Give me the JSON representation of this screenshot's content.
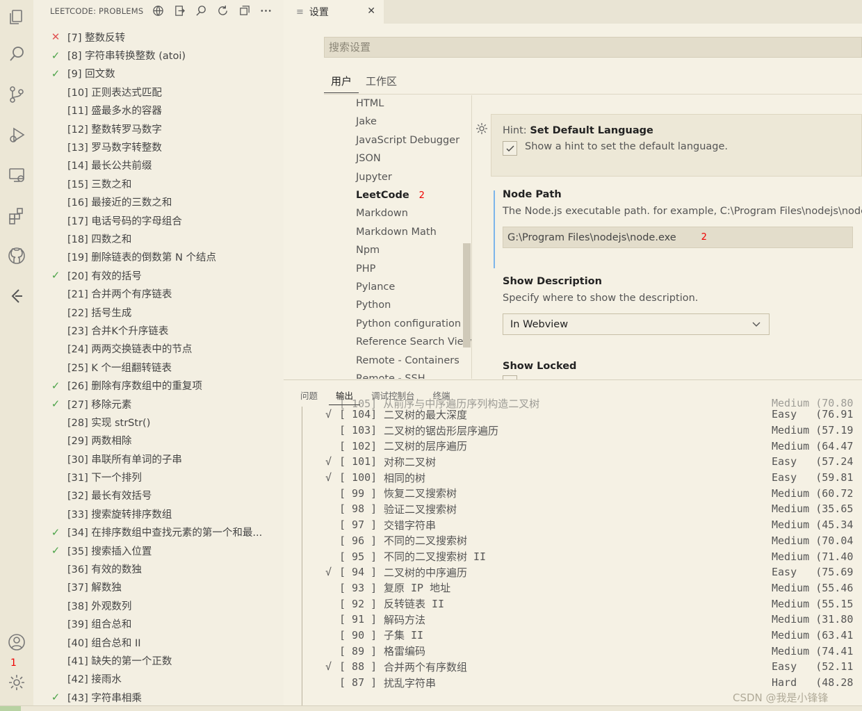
{
  "sidebar": {
    "title": "LEETCODE: PROBLEMS",
    "problems": [
      {
        "status": "fail",
        "label": "[7] 整数反转"
      },
      {
        "status": "ok",
        "label": "[8] 字符串转换整数 (atoi)"
      },
      {
        "status": "ok",
        "label": "[9] 回文数"
      },
      {
        "status": "",
        "label": "[10] 正则表达式匹配"
      },
      {
        "status": "",
        "label": "[11] 盛最多水的容器"
      },
      {
        "status": "",
        "label": "[12] 整数转罗马数字"
      },
      {
        "status": "",
        "label": "[13] 罗马数字转整数"
      },
      {
        "status": "",
        "label": "[14] 最长公共前缀"
      },
      {
        "status": "",
        "label": "[15] 三数之和"
      },
      {
        "status": "",
        "label": "[16] 最接近的三数之和"
      },
      {
        "status": "",
        "label": "[17] 电话号码的字母组合"
      },
      {
        "status": "",
        "label": "[18] 四数之和"
      },
      {
        "status": "",
        "label": "[19] 删除链表的倒数第 N 个结点"
      },
      {
        "status": "ok",
        "label": "[20] 有效的括号"
      },
      {
        "status": "",
        "label": "[21] 合并两个有序链表"
      },
      {
        "status": "",
        "label": "[22] 括号生成"
      },
      {
        "status": "",
        "label": "[23] 合并K个升序链表"
      },
      {
        "status": "",
        "label": "[24] 两两交换链表中的节点"
      },
      {
        "status": "",
        "label": "[25] K 个一组翻转链表"
      },
      {
        "status": "ok",
        "label": "[26] 删除有序数组中的重复项"
      },
      {
        "status": "ok",
        "label": "[27] 移除元素"
      },
      {
        "status": "",
        "label": "[28] 实现 strStr()"
      },
      {
        "status": "",
        "label": "[29] 两数相除"
      },
      {
        "status": "",
        "label": "[30] 串联所有单词的子串"
      },
      {
        "status": "",
        "label": "[31] 下一个排列"
      },
      {
        "status": "",
        "label": "[32] 最长有效括号"
      },
      {
        "status": "",
        "label": "[33] 搜索旋转排序数组"
      },
      {
        "status": "ok",
        "label": "[34] 在排序数组中查找元素的第一个和最..."
      },
      {
        "status": "ok",
        "label": "[35] 搜索插入位置"
      },
      {
        "status": "",
        "label": "[36] 有效的数独"
      },
      {
        "status": "",
        "label": "[37] 解数独"
      },
      {
        "status": "",
        "label": "[38] 外观数列"
      },
      {
        "status": "",
        "label": "[39] 组合总和"
      },
      {
        "status": "",
        "label": "[40] 组合总和 II"
      },
      {
        "status": "",
        "label": "[41] 缺失的第一个正数"
      },
      {
        "status": "",
        "label": "[42] 接雨水"
      },
      {
        "status": "ok",
        "label": "[43] 字符串相乘"
      }
    ]
  },
  "activity": {
    "badge": "1"
  },
  "editor": {
    "tab_label": "设置",
    "tab_icon": "≡",
    "close": "✕"
  },
  "settings": {
    "search_placeholder": "搜索设置",
    "scopes": [
      "用户",
      "工作区"
    ],
    "toc": [
      "HTML",
      "Jake",
      "JavaScript Debugger",
      "JSON",
      "Jupyter",
      "LeetCode",
      "Markdown",
      "Markdown Math",
      "Npm",
      "PHP",
      "Pylance",
      "Python",
      "Python configuration",
      "Reference Search View",
      "Remote - Containers",
      "Remote - SSH"
    ],
    "toc_active": "LeetCode",
    "toc_active_count": "2",
    "hint": {
      "category": "Hint: ",
      "title": "Set Default Language",
      "desc": "Show a hint to set the default language.",
      "checked": true
    },
    "node_path": {
      "title": "Node Path",
      "desc": "The Node.js executable path. for example, C:\\Program Files\\nodejs\\node.exe",
      "value": "G:\\Program Files\\nodejs\\node.exe",
      "badge": "2"
    },
    "show_description": {
      "title": "Show Description",
      "desc": "Specify where to show the description.",
      "value": "In Webview"
    },
    "show_locked": {
      "title": "Show Locked"
    }
  },
  "panel": {
    "tabs": [
      "问题",
      "输出",
      "调试控制台",
      "终端"
    ],
    "active_tab": "输出",
    "partial_top": "[ 105] 从前序与中序遍历序列构造二叉树",
    "partial_top_diff": "Medium (70.80",
    "rows": [
      {
        "mark": "√",
        "num": "[ 104]",
        "title": "二叉树的最大深度",
        "diff": "Easy   (76.91"
      },
      {
        "mark": "",
        "num": "[ 103]",
        "title": "二叉树的锯齿形层序遍历",
        "diff": "Medium (57.19"
      },
      {
        "mark": "",
        "num": "[ 102]",
        "title": "二叉树的层序遍历",
        "diff": "Medium (64.47"
      },
      {
        "mark": "√",
        "num": "[ 101]",
        "title": "对称二叉树",
        "diff": "Easy   (57.24"
      },
      {
        "mark": "√",
        "num": "[ 100]",
        "title": "相同的树",
        "diff": "Easy   (59.81"
      },
      {
        "mark": "",
        "num": "[ 99 ]",
        "title": "恢复二叉搜索树",
        "diff": "Medium (60.72"
      },
      {
        "mark": "",
        "num": "[ 98 ]",
        "title": "验证二叉搜索树",
        "diff": "Medium (35.65"
      },
      {
        "mark": "",
        "num": "[ 97 ]",
        "title": "交错字符串",
        "diff": "Medium (45.34"
      },
      {
        "mark": "",
        "num": "[ 96 ]",
        "title": "不同的二叉搜索树",
        "diff": "Medium (70.04"
      },
      {
        "mark": "",
        "num": "[ 95 ]",
        "title": "不同的二叉搜索树 II",
        "diff": "Medium (71.40"
      },
      {
        "mark": "√",
        "num": "[ 94 ]",
        "title": "二叉树的中序遍历",
        "diff": "Easy   (75.69"
      },
      {
        "mark": "",
        "num": "[ 93 ]",
        "title": "复原 IP 地址",
        "diff": "Medium (55.46"
      },
      {
        "mark": "",
        "num": "[ 92 ]",
        "title": "反转链表 II",
        "diff": "Medium (55.15"
      },
      {
        "mark": "",
        "num": "[ 91 ]",
        "title": "解码方法",
        "diff": "Medium (31.80"
      },
      {
        "mark": "",
        "num": "[ 90 ]",
        "title": "子集 II",
        "diff": "Medium (63.41"
      },
      {
        "mark": "",
        "num": "[ 89 ]",
        "title": "格雷编码",
        "diff": "Medium (74.41"
      },
      {
        "mark": "√",
        "num": "[ 88 ]",
        "title": "合并两个有序数组",
        "diff": "Easy   (52.11"
      },
      {
        "mark": "",
        "num": "[ 87 ]",
        "title": "扰乱字符串",
        "diff": "Hard   (48.28"
      }
    ]
  },
  "watermark": "CSDN @我是小锋锋"
}
